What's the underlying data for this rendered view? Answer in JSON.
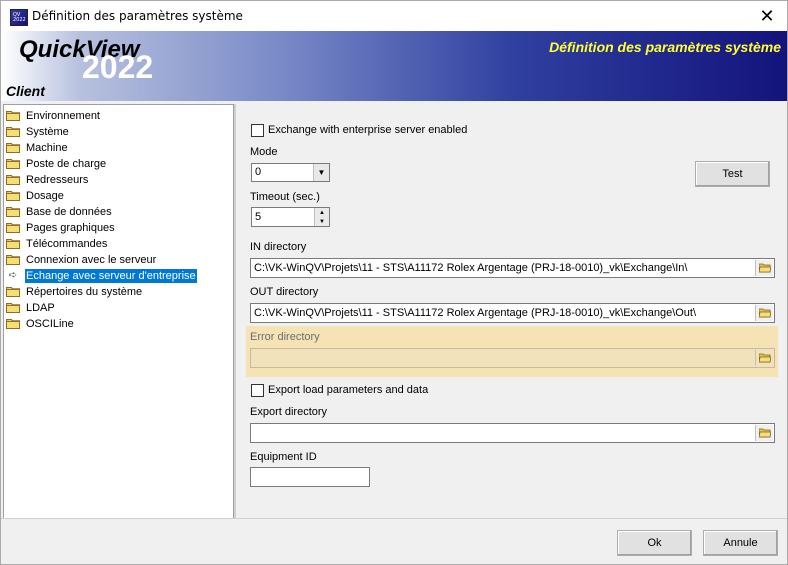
{
  "window": {
    "title": "Définition des paramètres système",
    "close_glyph": "✕"
  },
  "app_icon": {
    "text": "QV 2022"
  },
  "banner": {
    "logo_name": "QuickView",
    "logo_year": "2022",
    "title": "Définition des paramètres système",
    "subtitle": "Client",
    "title_color": "#ffff33"
  },
  "tree": {
    "items": [
      {
        "label": "Environnement"
      },
      {
        "label": "Système"
      },
      {
        "label": "Machine"
      },
      {
        "label": "Poste de charge"
      },
      {
        "label": "Redresseurs"
      },
      {
        "label": "Dosage"
      },
      {
        "label": "Base de données"
      },
      {
        "label": "Pages graphiques"
      },
      {
        "label": "Télécommandes"
      },
      {
        "label": "Connexion avec le serveur"
      },
      {
        "label": "Echange avec serveur d'entreprise",
        "selected": true
      },
      {
        "label": "Répertoires du système"
      },
      {
        "label": "LDAP"
      },
      {
        "label": "OSCILine"
      }
    ]
  },
  "form": {
    "exchange_enabled_label": "Exchange with enterprise server enabled",
    "exchange_enabled": false,
    "mode_label": "Mode",
    "mode_value": "0",
    "test_button": "Test",
    "timeout_label": "Timeout (sec.)",
    "timeout_value": "5",
    "in_dir_label": "IN directory",
    "in_dir_value": "C:\\VK-WinQV\\Projets\\11 - STS\\A11172 Rolex Argentage (PRJ-18-0010)_vk\\Exchange\\In\\",
    "out_dir_label": "OUT directory",
    "out_dir_value": "C:\\VK-WinQV\\Projets\\11 - STS\\A11172 Rolex Argentage (PRJ-18-0010)_vk\\Exchange\\Out\\",
    "error_dir_label": "Error directory",
    "error_dir_value": "",
    "export_label": "Export load parameters and data",
    "export_checked": false,
    "export_dir_label": "Export directory",
    "export_dir_value": "",
    "equipment_id_label": "Equipment ID",
    "equipment_id_value": ""
  },
  "footer": {
    "ok": "Ok",
    "cancel": "Annule"
  },
  "colors": {
    "selection": "#0078d7",
    "highlight": "#f5e2b5"
  }
}
